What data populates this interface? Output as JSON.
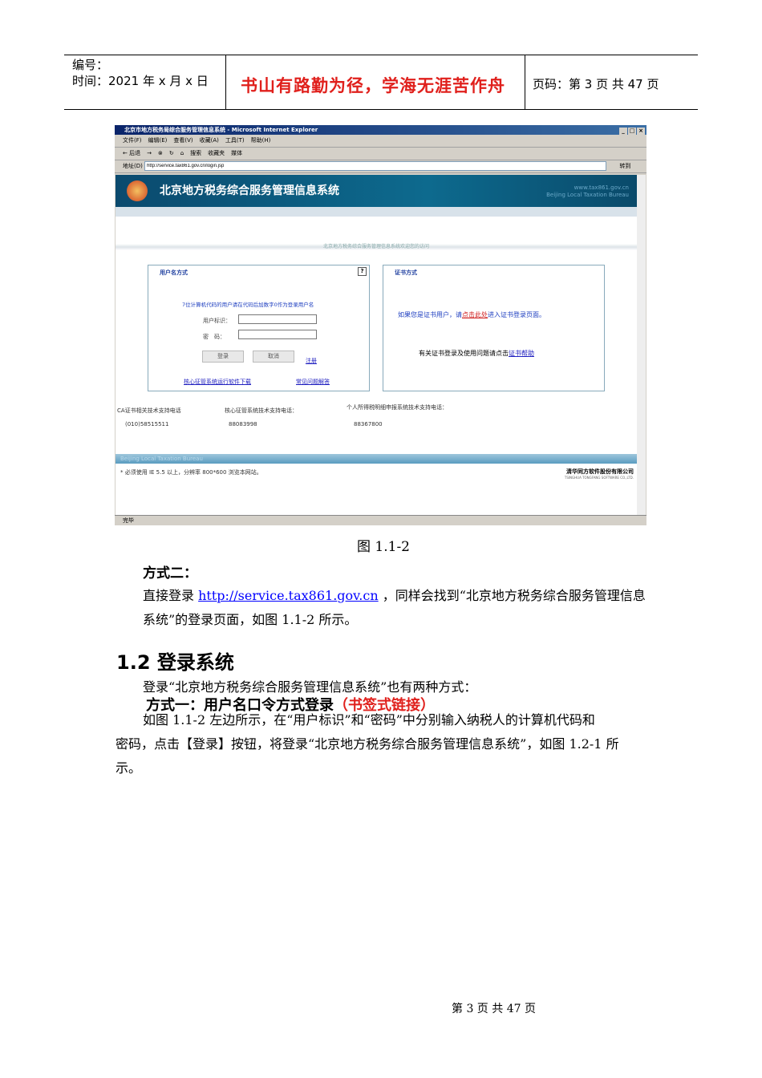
{
  "header": {
    "number_label": "编号：",
    "time_label": "时间：2021 年 x 月 x 日",
    "motto": "书山有路勤为径，学海无涯苦作舟",
    "page_label": "页码：第 3 页  共 47 页"
  },
  "browser": {
    "title": "北京市地方税务局综合服务管理信息系统 - Microsoft Internet Explorer",
    "menu": [
      "文件(F)",
      "编辑(E)",
      "查看(V)",
      "收藏(A)",
      "工具(T)",
      "帮助(H)"
    ],
    "toolbar": [
      "← 后退",
      "→",
      "⊗",
      "↻",
      "⌂",
      "搜索",
      "收藏夹",
      "媒体"
    ],
    "address_label": "地址(D)",
    "address": "http://service.tax861.gov.cn/login.jsp",
    "go": "转到",
    "status": "完毕"
  },
  "site": {
    "title": "北京地方税务综合服务管理信息系统",
    "url": "www.tax861.gov.cn",
    "english": "Beijing Local Taxation Bureau",
    "welcome": "北京地方税务综合服务管理信息系统欢迎您的访问",
    "user_box": {
      "title": "用户名方式",
      "help": "?",
      "hint": "7位计算机代码的用户请在代码后加数字0作为登录用户名",
      "user_label": "用户标识：",
      "password_label": "密　码：",
      "login": "登录",
      "cancel": "取消",
      "register": "注册",
      "download": "核心征管系统运行软件下载",
      "faq": "常见问题解答"
    },
    "cert_box": {
      "title": "证书方式",
      "line1_a": "如果您是证书用户，请",
      "line1_link": "点击此处",
      "line1_b": "进入证书登录页面。",
      "line2": "有关证书登录及使用问题请点击",
      "line2_link": "证书帮助"
    },
    "support": [
      {
        "label": "CA证书相关技术支持电话",
        "phone": "(010)58515511"
      },
      {
        "label": "核心征管系统技术支持电话：",
        "phone": "88083998"
      },
      {
        "label": "个人所得税明细申报系统技术支持电话：",
        "phone": "88367800"
      }
    ],
    "footer_english": "Beijing Local Taxation Bureau",
    "notice": "* 必须使用 IE 5.5 以上，分辨率 800*600 浏览本网站。",
    "company": "清华同方软件股份有限公司",
    "company_en": "TSINGHUA TONGFANG SOFTWARE CO.,LTD."
  },
  "body": {
    "caption": "图 1.1-2",
    "method2_title": "方式二：",
    "para1_a": "直接登录 ",
    "para1_link": "http://service.tax861.gov.cn",
    "para1_b": " ，同样会找到“北京地方税务综合服务管理信息",
    "para1_c": "系统”的登录页面，如图 1.1-2 所示。",
    "section": "1.2  登录系统",
    "para2": "登录“北京地方税务综合服务管理信息系统”也有两种方式：",
    "method1_a": "方式一：用户名口令方式登录",
    "method1_b": "（书签式链接）",
    "para3_a": "如图 1.1-2 左边所示，在“用户标识”和“密码”中分别输入纳税人的计算机代码和",
    "para3_b": "密码，点击【登录】按钮，将登录“北京地方税务综合服务管理信息系统”，如图 1.2-1 所",
    "para3_c": "示。"
  },
  "footer": {
    "page": "第  3  页  共  47  页"
  }
}
